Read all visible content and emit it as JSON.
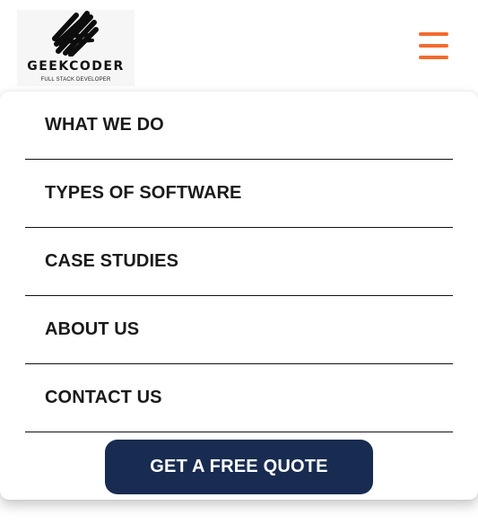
{
  "brand": {
    "name": "GEEKCODER",
    "tagline": "FULL STACK DEVELOPER",
    "logo_icon": "scribble-brush-mark"
  },
  "header": {
    "menu_icon": "hamburger-menu-icon",
    "menu_icon_color": "#f26b2e"
  },
  "nav": {
    "items": [
      {
        "label": "WHAT WE DO"
      },
      {
        "label": "TYPES OF SOFTWARE"
      },
      {
        "label": "CASE STUDIES"
      },
      {
        "label": "ABOUT US"
      },
      {
        "label": "CONTACT US"
      }
    ]
  },
  "cta": {
    "label": "GET A FREE QUOTE",
    "color": "#182c51"
  }
}
